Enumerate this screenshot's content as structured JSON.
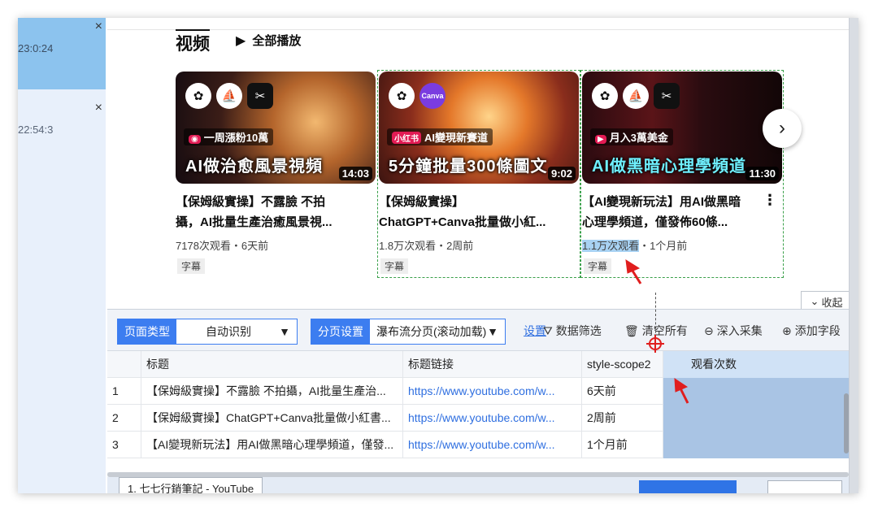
{
  "sidebar": {
    "items": [
      {
        "time": "23:0:24",
        "close": "×"
      },
      {
        "time": "22:54:3",
        "close": "×"
      }
    ]
  },
  "youtube": {
    "section_title": "视频",
    "play_all": "全部播放",
    "next_icon": "chevron-right-icon",
    "videos": [
      {
        "thumb_tag": "一周漲粉10萬",
        "thumb_text": "AI做治愈風景視頻",
        "duration": "14:03",
        "title": "【保姆級實操】不露臉 不拍\n攝，AI批量生產治癒風景視...",
        "views": "7178次观看",
        "ago": "・6天前",
        "badge": "字幕"
      },
      {
        "thumb_tag": "AI變現新賽道",
        "thumb_text": "5分鐘批量300條圖文",
        "duration": "9:02",
        "title": "【保姆級實操】\nChatGPT+Canva批量做小紅...",
        "views": "1.8万次观看",
        "ago": "・2周前",
        "badge": "字幕"
      },
      {
        "thumb_tag": "月入3萬美金",
        "thumb_text": "AI做黑暗心理學頻道",
        "duration": "11:30",
        "title": "【AI變現新玩法】用AI做黑暗\n心理學頻道，僅發佈60條...",
        "views": "1.1万次观看",
        "ago": "・1个月前",
        "badge": "字幕"
      }
    ]
  },
  "collapse_label": "收起",
  "toolbar": {
    "page_type_label": "页面类型",
    "page_type_value": "自动识别",
    "paging_label": "分页设置",
    "paging_value": "瀑布流分页(滚动加载)",
    "settings_link": "设置",
    "filter": "数据筛选",
    "clear": "清空所有",
    "deep": "深入采集",
    "add_field": "添加字段"
  },
  "table": {
    "headers": [
      "",
      "标题",
      "标题链接",
      "style-scope2",
      "观看次数"
    ],
    "rows": [
      [
        "1",
        "【保姆級實操】不露臉 不拍攝，AI批量生產治...",
        "https://www.youtube.com/w...",
        "6天前",
        ""
      ],
      [
        "2",
        "【保姆級實操】ChatGPT+Canva批量做小紅書...",
        "https://www.youtube.com/w...",
        "2周前",
        ""
      ],
      [
        "3",
        "【AI變現新玩法】用AI做黑暗心理學頻道，僅發...",
        "https://www.youtube.com/w...",
        "1个月前",
        ""
      ]
    ]
  },
  "bottom_tab": "1. 七七行銷筆記 - YouTube",
  "colors": {
    "accent": "#3c7df0",
    "highlight": "#a9c4e4",
    "selection": "#3aa04a",
    "marker": "#e01e1e"
  }
}
